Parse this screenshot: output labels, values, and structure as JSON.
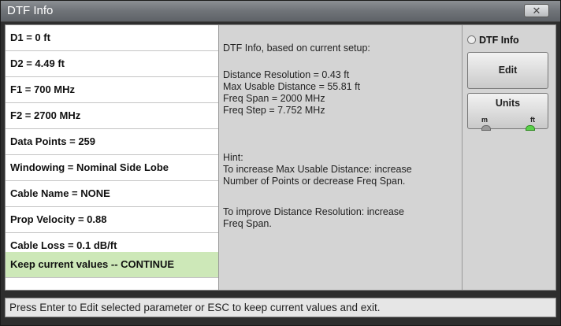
{
  "window": {
    "title": "DTF Info",
    "close_label": "✕"
  },
  "params": [
    "D1 = 0 ft",
    "D2 = 4.49 ft",
    "F1 = 700 MHz",
    "F2 = 2700 MHz",
    "Data Points = 259",
    "Windowing = Nominal Side Lobe",
    "Cable Name = NONE",
    "Prop Velocity = 0.88",
    "Cable Loss = 0.1 dB/ft",
    "Keep current values -- CONTINUE"
  ],
  "selected_index": 9,
  "info": {
    "heading": "DTF Info, based on current setup:",
    "stats": "Distance Resolution = 0.43 ft\nMax Usable Distance = 55.81 ft\nFreq Span = 2000 MHz\nFreq Step = 7.752 MHz",
    "hint": "Hint:\nTo increase Max Usable Distance: increase\nNumber of Points or decrease Freq Span.",
    "hint2": "To improve Distance Resolution: increase\nFreq Span."
  },
  "side": {
    "radio_label": "DTF Info",
    "edit_label": "Edit",
    "units_label": "Units",
    "unit_m": "m",
    "unit_ft": "ft",
    "selected_unit": "ft"
  },
  "status_text": "Press Enter to Edit selected parameter or ESC to keep current values and exit.",
  "colors": {
    "selected_row": "#cde8b8",
    "active_led": "#5ad04a"
  }
}
